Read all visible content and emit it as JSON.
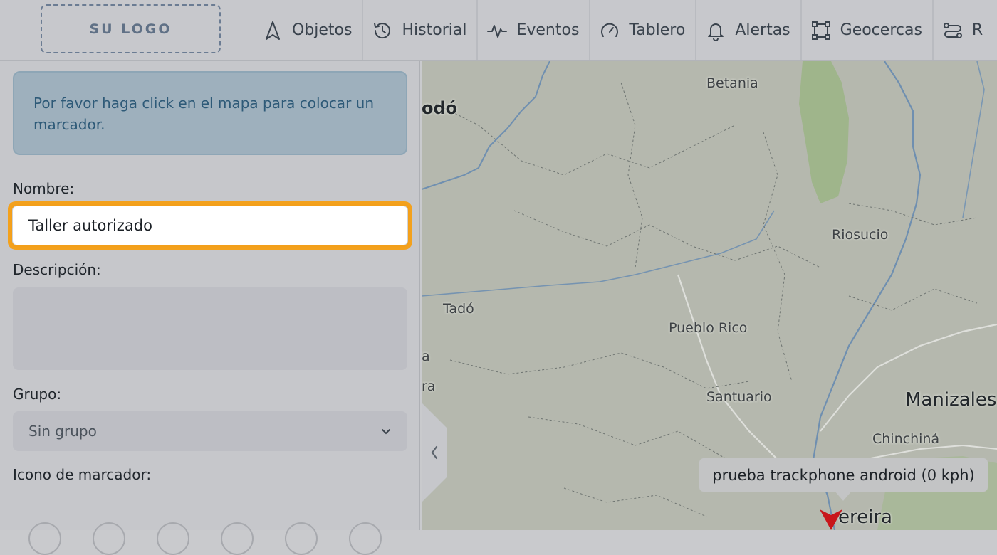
{
  "header": {
    "logo_text": "SU LOGO",
    "nav": [
      {
        "label": "Objetos",
        "icon": "navigation-arrow-icon"
      },
      {
        "label": "Historial",
        "icon": "history-icon"
      },
      {
        "label": "Eventos",
        "icon": "activity-icon"
      },
      {
        "label": "Tablero",
        "icon": "gauge-icon"
      },
      {
        "label": "Alertas",
        "icon": "bell-icon"
      },
      {
        "label": "Geocercas",
        "icon": "geofence-icon"
      },
      {
        "label": "R",
        "icon": "routes-icon"
      }
    ]
  },
  "panel": {
    "info_message": "Por favor haga click en el mapa para colocar un marcador.",
    "name_label": "Nombre:",
    "name_value": "Taller autorizado",
    "description_label": "Descripción:",
    "description_value": "",
    "group_label": "Grupo:",
    "group_selected": "Sin grupo",
    "icon_label": "Icono de marcador:"
  },
  "map": {
    "places": [
      {
        "name": "Betania",
        "size": "normal"
      },
      {
        "name": "odó",
        "size": "bold"
      },
      {
        "name": "Riosucio",
        "size": "normal"
      },
      {
        "name": "Tadó",
        "size": "normal"
      },
      {
        "name": "Pueblo Rico",
        "size": "normal"
      },
      {
        "name": "Santuario",
        "size": "normal"
      },
      {
        "name": "Manizales",
        "size": "big"
      },
      {
        "name": "Chinchiná",
        "size": "normal"
      },
      {
        "name": "ereira",
        "size": "big"
      },
      {
        "name": "a",
        "size": "normal"
      },
      {
        "name": "ra",
        "size": "normal"
      }
    ],
    "tooltip": "prueba trackphone android (0 kph)",
    "marker_color": "#c8161b"
  },
  "colors": {
    "focus_ring": "#f3a11d",
    "alert_bg": "#9eb0bd",
    "alert_text": "#2e5a78"
  }
}
